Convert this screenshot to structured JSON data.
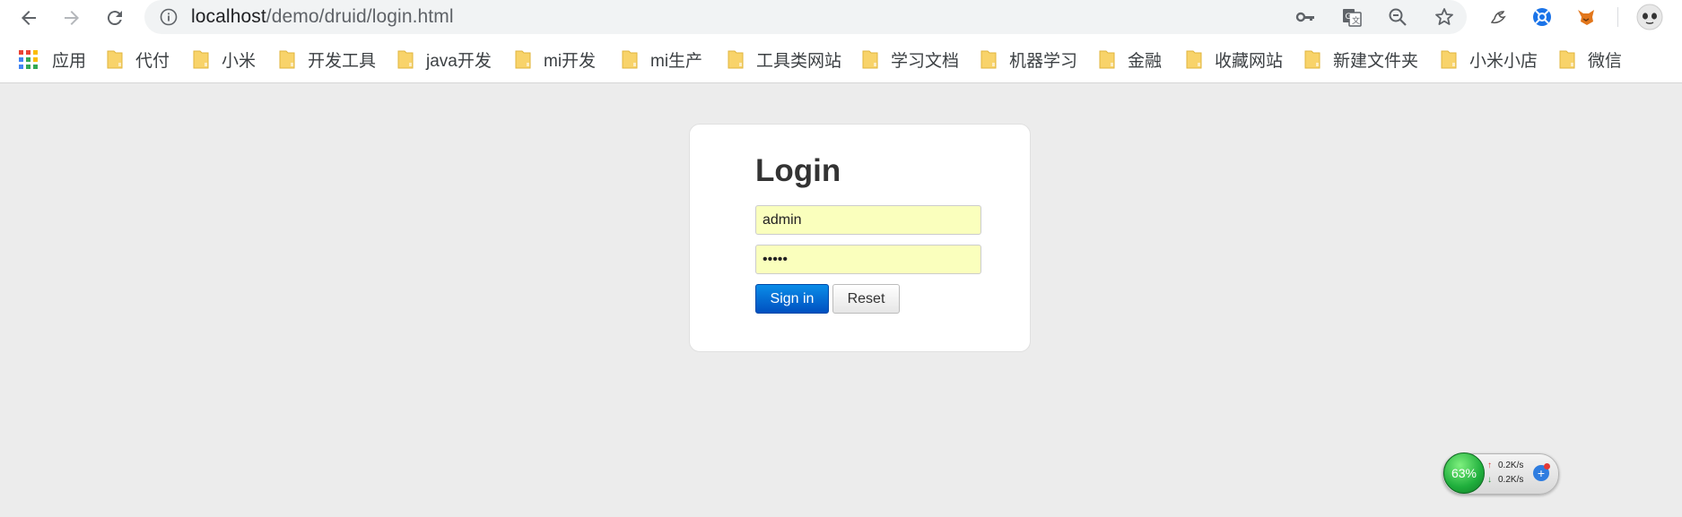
{
  "browser": {
    "url_host": "localhost",
    "url_path": "/demo/druid/login.html",
    "bookmarks": [
      {
        "label": "应用"
      },
      {
        "label": "代付"
      },
      {
        "label": "小米"
      },
      {
        "label": "开发工具"
      },
      {
        "label": "java开发"
      },
      {
        "label": "mi开发"
      },
      {
        "label": "mi生产"
      },
      {
        "label": "工具类网站"
      },
      {
        "label": "学习文档"
      },
      {
        "label": "机器学习"
      },
      {
        "label": "金融"
      },
      {
        "label": "收藏网站"
      },
      {
        "label": "新建文件夹"
      },
      {
        "label": "小米小店"
      },
      {
        "label": "微信"
      }
    ]
  },
  "login": {
    "title": "Login",
    "username_value": "admin",
    "password_value": "admin",
    "signin_label": "Sign in",
    "reset_label": "Reset"
  },
  "netmon": {
    "percent": "63%",
    "upload": "0.2K/s",
    "download": "0.2K/s",
    "plus": "+"
  },
  "colors": {
    "input_bg": "#faffbd",
    "signin_bg": "#0a6fd8",
    "page_bg": "#ececec",
    "netmon_green": "#1fae3c"
  }
}
